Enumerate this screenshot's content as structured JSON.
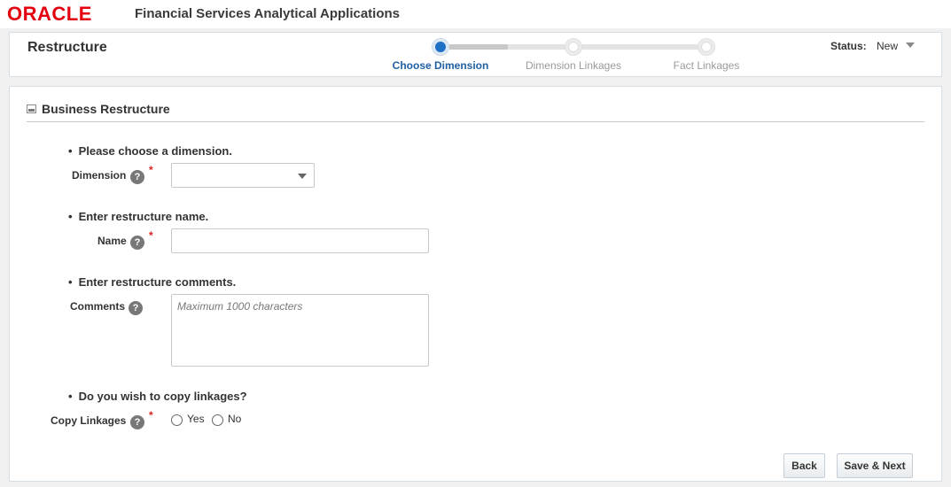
{
  "app": {
    "logo": "ORACLE",
    "title": "Financial Services Analytical Applications"
  },
  "train": {
    "page_title": "Restructure",
    "stops": [
      {
        "label": "Choose Dimension",
        "active": true
      },
      {
        "label": "Dimension Linkages",
        "active": false
      },
      {
        "label": "Fact Linkages",
        "active": false
      }
    ],
    "status_label": "Status:",
    "status_value": "New"
  },
  "section": {
    "title": "Business Restructure"
  },
  "form": {
    "dimension": {
      "instruction": "Please choose a dimension.",
      "label": "Dimension",
      "value": ""
    },
    "name": {
      "instruction": "Enter restructure name.",
      "label": "Name",
      "value": ""
    },
    "comments": {
      "instruction": "Enter restructure comments.",
      "label": "Comments",
      "placeholder": "Maximum 1000 characters",
      "value": ""
    },
    "copy_linkages": {
      "instruction": "Do you wish to copy linkages?",
      "label": "Copy Linkages",
      "options": [
        "Yes",
        "No"
      ]
    },
    "help_glyph": "?",
    "required_glyph": "*",
    "bullet_glyph": "•"
  },
  "buttons": {
    "back": "Back",
    "save_next": "Save & Next"
  },
  "colors": {
    "brand": "#e4000f",
    "active_train": "#1e6fc6",
    "required": "#e02020"
  }
}
